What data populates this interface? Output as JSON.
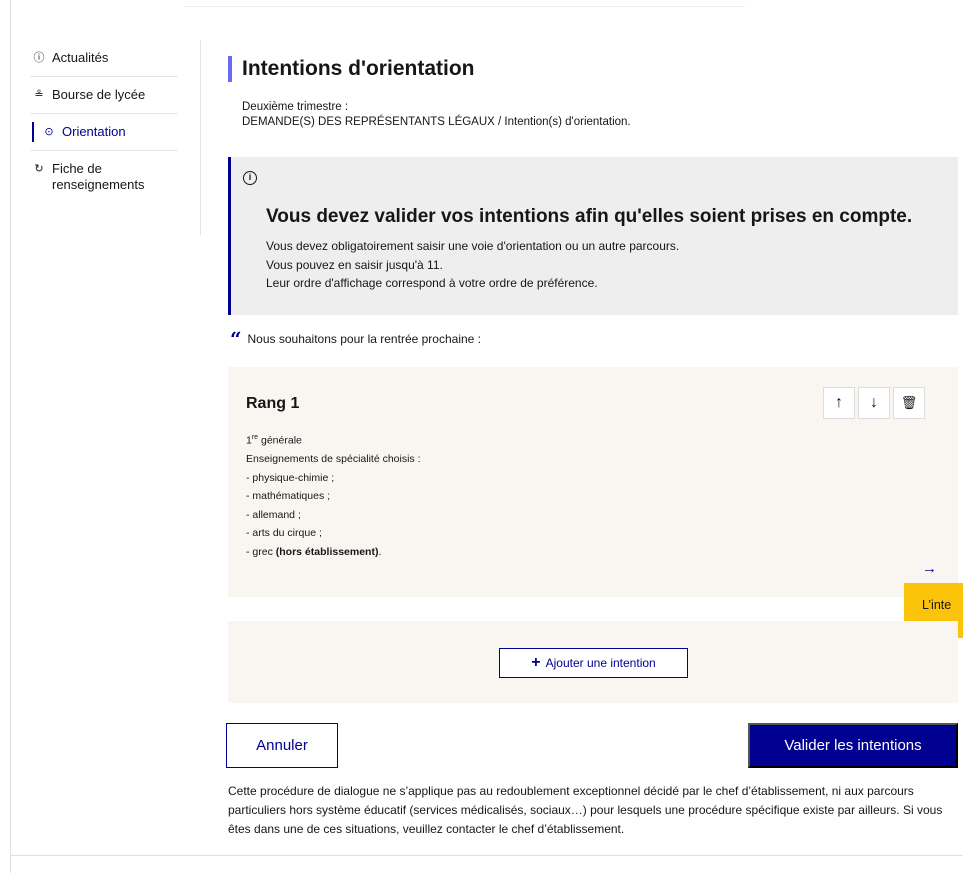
{
  "sidebar": {
    "items": [
      {
        "label": "Actualités",
        "icon": "info-circle-icon",
        "glyph": "ⓘ"
      },
      {
        "label": "Bourse de lycée",
        "icon": "money-icon",
        "glyph": "≗"
      },
      {
        "label": "Orientation",
        "icon": "compass-icon",
        "glyph": "⊙"
      },
      {
        "label": "Fiche de renseignements",
        "icon": "refresh-doc-icon",
        "glyph": "↻"
      }
    ]
  },
  "main": {
    "title": "Intentions d'orientation",
    "subtitle_line1": "Deuxième trimestre :",
    "subtitle_line2": "DEMANDE(S) DES REPRÉSENTANTS LÉGAUX / Intention(s) d'orientation."
  },
  "alert": {
    "icon_glyph": "i",
    "title": "Vous devez valider vos intentions afin qu'elles soient prises en compte.",
    "line1": "Vous devez obligatoirement saisir une voie d'orientation ou un autre parcours.",
    "line2": "Vous pouvez en saisir jusqu'à 11.",
    "line3": "Leur ordre d'affichage correspond à votre ordre de préférence."
  },
  "quote": {
    "mark": "“",
    "text": "Nous souhaitons pour la rentrée prochaine :"
  },
  "rank": {
    "title": "Rang 1",
    "level_num": "1",
    "level_sup": "re",
    "level_rest": " générale",
    "specialities_label": "Enseignements de spécialité choisis :",
    "items": [
      "- physique-chimie ;",
      "- mathématiques ;",
      "- allemand ;",
      "- arts du cirque ;"
    ],
    "last_item_prefix": "- grec ",
    "last_item_bold": "(hors établissement)",
    "last_item_suffix": ".",
    "actions": {
      "up": "↑",
      "down": "↓",
      "delete": "🗑"
    },
    "arrow": "→"
  },
  "tooltip": {
    "text": "L’inte"
  },
  "add": {
    "plus": "+",
    "label": "Ajouter une intention"
  },
  "buttons": {
    "cancel": "Annuler",
    "validate": "Valider les intentions"
  },
  "footnote": "Cette procédure de dialogue ne s’applique pas au redoublement exceptionnel décidé par le chef d’établissement, ni aux parcours particuliers hors système éducatif (services médicalisés, sociaux…) pour lesquels une procédure spécifique existe par ailleurs. Si vous êtes dans une de ces situations, veuillez contacter le chef d’établissement.",
  "colors": {
    "primary": "#000091",
    "accent_bar": "#6a6af4",
    "tooltip": "#fcc30b",
    "card_bg": "#f9f6f2",
    "alert_bg": "#eeeeee"
  }
}
